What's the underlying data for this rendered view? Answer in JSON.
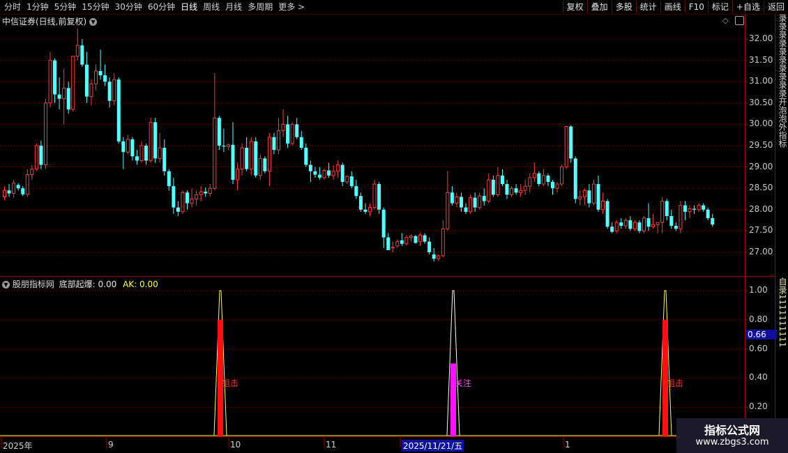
{
  "toolbar": {
    "periods": [
      "分时",
      "1分钟",
      "5分钟",
      "15分钟",
      "30分钟",
      "60分钟",
      "日线",
      "周线",
      "月线",
      "多周期",
      "更多 >"
    ],
    "active_period": "日线",
    "right_buttons": [
      "复权",
      "叠加",
      "多股",
      "统计",
      "画线",
      "F10",
      "标记",
      "+自选",
      "返回"
    ]
  },
  "main_chart": {
    "title": "中信证券(日线,前复权)",
    "y_ticks": [
      "32.00",
      "31.50",
      "31.00",
      "30.50",
      "30.00",
      "29.50",
      "29.00",
      "28.50",
      "28.00",
      "27.50",
      "27.00"
    ],
    "colors": {
      "up": "#ff3c3c",
      "down": "#54ffff",
      "grid": "#8a0000"
    },
    "candles": [
      [
        28.3,
        28.55,
        28.22,
        28.45
      ],
      [
        28.45,
        28.6,
        28.3,
        28.38
      ],
      [
        28.38,
        28.7,
        28.28,
        28.62
      ],
      [
        28.58,
        28.62,
        28.45,
        28.5
      ],
      [
        28.5,
        28.55,
        28.32,
        28.36
      ],
      [
        28.36,
        28.95,
        28.3,
        28.82
      ],
      [
        28.82,
        29.05,
        28.7,
        28.95
      ],
      [
        28.95,
        29.55,
        28.9,
        29.5
      ],
      [
        29.5,
        29.62,
        28.95,
        29.05
      ],
      [
        29.05,
        30.6,
        28.95,
        30.5
      ],
      [
        30.5,
        31.7,
        30.4,
        31.5
      ],
      [
        31.5,
        31.55,
        30.5,
        30.7
      ],
      [
        30.7,
        31.1,
        30.35,
        30.6
      ],
      [
        30.6,
        31.3,
        30.0,
        30.85
      ],
      [
        30.85,
        31.0,
        30.25,
        30.35
      ],
      [
        30.35,
        31.6,
        30.3,
        31.6
      ],
      [
        31.6,
        32.25,
        31.5,
        31.85
      ],
      [
        31.85,
        32.0,
        31.35,
        31.4
      ],
      [
        31.4,
        31.7,
        30.5,
        30.65
      ],
      [
        30.65,
        31.05,
        30.45,
        30.95
      ],
      [
        30.95,
        31.4,
        30.8,
        31.25
      ],
      [
        31.25,
        31.75,
        31.05,
        31.15
      ],
      [
        31.15,
        31.4,
        30.9,
        31.0
      ],
      [
        31.0,
        31.1,
        30.4,
        30.55
      ],
      [
        30.55,
        31.2,
        30.45,
        31.05
      ],
      [
        31.05,
        31.1,
        29.55,
        29.6
      ],
      [
        29.6,
        29.7,
        28.95,
        29.35
      ],
      [
        29.35,
        29.75,
        29.3,
        29.65
      ],
      [
        29.65,
        29.7,
        29.15,
        29.25
      ],
      [
        29.25,
        29.4,
        29.05,
        29.15
      ],
      [
        29.15,
        29.6,
        29.1,
        29.5
      ],
      [
        29.5,
        29.55,
        29.05,
        29.15
      ],
      [
        29.15,
        30.15,
        29.1,
        30.05
      ],
      [
        30.05,
        30.15,
        29.1,
        29.2
      ],
      [
        29.2,
        29.8,
        29.1,
        29.45
      ],
      [
        29.45,
        29.65,
        28.8,
        28.9
      ],
      [
        28.9,
        28.95,
        28.45,
        28.55
      ],
      [
        28.55,
        28.75,
        27.9,
        28.05
      ],
      [
        28.05,
        28.2,
        27.85,
        27.95
      ],
      [
        27.95,
        28.45,
        27.9,
        28.4
      ],
      [
        28.4,
        28.45,
        28.0,
        28.15
      ],
      [
        28.15,
        28.5,
        28.05,
        28.25
      ],
      [
        28.25,
        28.45,
        28.1,
        28.35
      ],
      [
        28.35,
        28.55,
        28.2,
        28.42
      ],
      [
        28.42,
        28.52,
        28.3,
        28.38
      ],
      [
        28.38,
        28.6,
        28.3,
        28.5
      ],
      [
        28.5,
        31.2,
        28.45,
        30.15
      ],
      [
        30.15,
        30.2,
        29.4,
        29.5
      ],
      [
        29.5,
        29.9,
        29.35,
        29.48
      ],
      [
        29.48,
        29.55,
        29.4,
        29.52
      ],
      [
        29.52,
        30.05,
        28.6,
        28.7
      ],
      [
        28.7,
        29.1,
        28.45,
        28.95
      ],
      [
        28.95,
        29.55,
        28.8,
        29.45
      ],
      [
        29.45,
        29.7,
        28.9,
        28.95
      ],
      [
        28.95,
        29.7,
        28.8,
        29.6
      ],
      [
        29.6,
        29.7,
        28.75,
        28.8
      ],
      [
        28.8,
        29.3,
        28.7,
        29.2
      ],
      [
        29.2,
        29.25,
        28.85,
        28.9
      ],
      [
        28.9,
        29.8,
        28.55,
        29.7
      ],
      [
        29.7,
        29.8,
        29.3,
        29.4
      ],
      [
        29.4,
        30.15,
        29.3,
        29.85
      ],
      [
        29.85,
        30.35,
        29.7,
        30.0
      ],
      [
        30.0,
        30.2,
        29.45,
        29.55
      ],
      [
        29.55,
        30.05,
        29.5,
        30.0
      ],
      [
        30.0,
        30.15,
        29.65,
        29.7
      ],
      [
        29.7,
        29.85,
        29.4,
        29.45
      ],
      [
        29.45,
        29.55,
        29.0,
        29.05
      ],
      [
        29.05,
        29.15,
        28.65,
        28.9
      ],
      [
        28.9,
        29.0,
        28.75,
        28.82
      ],
      [
        28.82,
        29.0,
        28.7,
        28.75
      ],
      [
        28.75,
        28.95,
        28.7,
        28.92
      ],
      [
        28.92,
        29.1,
        28.75,
        28.8
      ],
      [
        28.8,
        29.05,
        28.7,
        28.9
      ],
      [
        28.9,
        29.15,
        28.75,
        29.05
      ],
      [
        29.05,
        29.1,
        28.55,
        28.65
      ],
      [
        28.65,
        28.8,
        28.6,
        28.78
      ],
      [
        28.78,
        28.9,
        28.5,
        28.55
      ],
      [
        28.55,
        28.7,
        28.25,
        28.32
      ],
      [
        28.32,
        28.4,
        27.95,
        28.0
      ],
      [
        28.0,
        28.15,
        27.9,
        27.95
      ],
      [
        27.95,
        28.15,
        27.85,
        28.05
      ],
      [
        28.05,
        28.7,
        28.0,
        28.6
      ],
      [
        28.6,
        28.65,
        27.9,
        28.0
      ],
      [
        28.0,
        28.05,
        27.1,
        27.35
      ],
      [
        27.35,
        27.45,
        27.05,
        27.05
      ],
      [
        27.1,
        27.25,
        27.0,
        27.12
      ],
      [
        27.15,
        27.3,
        27.1,
        27.25
      ],
      [
        27.28,
        27.45,
        27.15,
        27.2
      ],
      [
        27.2,
        27.4,
        27.15,
        27.35
      ],
      [
        27.35,
        27.42,
        27.25,
        27.38
      ],
      [
        27.38,
        27.4,
        27.2,
        27.22
      ],
      [
        27.25,
        27.45,
        27.15,
        27.4
      ],
      [
        27.4,
        27.45,
        27.2,
        27.25
      ],
      [
        27.25,
        27.35,
        26.95,
        27.0
      ],
      [
        26.95,
        27.1,
        26.78,
        26.85
      ],
      [
        26.85,
        26.95,
        26.8,
        26.92
      ],
      [
        26.92,
        27.75,
        26.88,
        27.55
      ],
      [
        27.55,
        28.9,
        27.5,
        28.4
      ],
      [
        28.4,
        28.55,
        28.1,
        28.15
      ],
      [
        28.15,
        28.4,
        28.05,
        28.3
      ],
      [
        28.3,
        28.4,
        27.95,
        28.05
      ],
      [
        28.05,
        28.15,
        27.9,
        27.95
      ],
      [
        27.95,
        28.35,
        27.9,
        28.28
      ],
      [
        28.28,
        28.4,
        27.95,
        28.05
      ],
      [
        28.05,
        28.4,
        28.0,
        28.32
      ],
      [
        28.32,
        28.5,
        28.1,
        28.2
      ],
      [
        28.2,
        28.85,
        28.15,
        28.7
      ],
      [
        28.7,
        28.8,
        28.3,
        28.35
      ],
      [
        28.35,
        29.0,
        28.3,
        28.8
      ],
      [
        28.8,
        28.95,
        28.55,
        28.6
      ],
      [
        28.6,
        28.7,
        28.25,
        28.35
      ],
      [
        28.35,
        28.55,
        28.3,
        28.5
      ],
      [
        28.5,
        28.6,
        28.35,
        28.4
      ],
      [
        28.4,
        28.6,
        28.3,
        28.45
      ],
      [
        28.45,
        28.7,
        28.35,
        28.55
      ],
      [
        28.55,
        28.85,
        28.4,
        28.75
      ],
      [
        28.75,
        29.1,
        28.65,
        28.85
      ],
      [
        28.85,
        28.9,
        28.55,
        28.6
      ],
      [
        28.6,
        28.95,
        28.55,
        28.8
      ],
      [
        28.8,
        28.85,
        28.55,
        28.65
      ],
      [
        28.65,
        28.7,
        28.35,
        28.5
      ],
      [
        28.5,
        28.65,
        28.4,
        28.6
      ],
      [
        28.6,
        29.05,
        28.55,
        29.0
      ],
      [
        29.0,
        29.95,
        28.95,
        29.95
      ],
      [
        29.95,
        29.98,
        29.1,
        29.2
      ],
      [
        29.2,
        29.25,
        28.15,
        28.25
      ],
      [
        28.25,
        28.45,
        28.1,
        28.3
      ],
      [
        28.3,
        28.5,
        28.1,
        28.45
      ],
      [
        28.45,
        28.6,
        28.05,
        28.15
      ],
      [
        28.15,
        28.7,
        28.1,
        28.6
      ],
      [
        28.6,
        28.8,
        27.95,
        28.0
      ],
      [
        28.0,
        28.4,
        27.9,
        28.2
      ],
      [
        28.2,
        28.25,
        27.55,
        27.6
      ],
      [
        27.6,
        27.7,
        27.45,
        27.48
      ],
      [
        27.5,
        27.75,
        27.45,
        27.7
      ],
      [
        27.7,
        27.8,
        27.55,
        27.62
      ],
      [
        27.62,
        27.8,
        27.55,
        27.75
      ],
      [
        27.75,
        27.85,
        27.5,
        27.55
      ],
      [
        27.55,
        27.75,
        27.5,
        27.7
      ],
      [
        27.7,
        27.75,
        27.45,
        27.5
      ],
      [
        27.5,
        27.85,
        27.45,
        27.8
      ],
      [
        27.8,
        28.15,
        27.5,
        27.6
      ],
      [
        27.6,
        27.9,
        27.55,
        27.65
      ],
      [
        27.65,
        27.7,
        27.45,
        27.7
      ],
      [
        27.7,
        28.3,
        27.45,
        28.2
      ],
      [
        28.2,
        28.25,
        27.75,
        27.85
      ],
      [
        27.85,
        28.0,
        27.55,
        27.62
      ],
      [
        27.62,
        27.7,
        27.5,
        27.55
      ],
      [
        27.55,
        28.2,
        27.45,
        28.1
      ],
      [
        28.1,
        28.2,
        27.75,
        27.95
      ],
      [
        27.95,
        28.1,
        27.8,
        28.02
      ],
      [
        28.02,
        28.1,
        27.9,
        28.0
      ],
      [
        28.0,
        28.15,
        27.95,
        28.1
      ],
      [
        28.1,
        28.15,
        27.95,
        28.0
      ],
      [
        28.0,
        28.05,
        27.75,
        27.8
      ],
      [
        27.8,
        27.9,
        27.6,
        27.65
      ]
    ]
  },
  "indicator": {
    "name": "股朋指标网",
    "label1": "底部起爆: 0.00",
    "label2": "AK: 0.00",
    "y_ticks": [
      "1.00",
      "0.80",
      "0.60",
      "0.40",
      "0.20"
    ],
    "cursor_value": "0.66",
    "signals": [
      {
        "label": "狙击",
        "value": 1.0,
        "bar": 0.8,
        "bar_color": "#ff1010",
        "text_color": "#ff3030"
      },
      {
        "label": "关注",
        "value": 1.0,
        "bar": 0.5,
        "bar_color": "#ff10ff",
        "text_color": "#ff40ff"
      },
      {
        "label": "狙击",
        "value": 1.0,
        "bar": 0.8,
        "bar_color": "#ff1010",
        "text_color": "#ff3030"
      }
    ]
  },
  "date_axis": {
    "labels": [
      "2025年",
      "9",
      "10",
      "11",
      "2025/11/21/五",
      "1"
    ]
  },
  "side_panel": {
    "top_text": "录录录录录录录录录录开泡泡外指标",
    "bottom_text": "自录1111111111"
  },
  "watermark": {
    "line1": "指标公式网",
    "line2": "www.zbgs3.com"
  }
}
